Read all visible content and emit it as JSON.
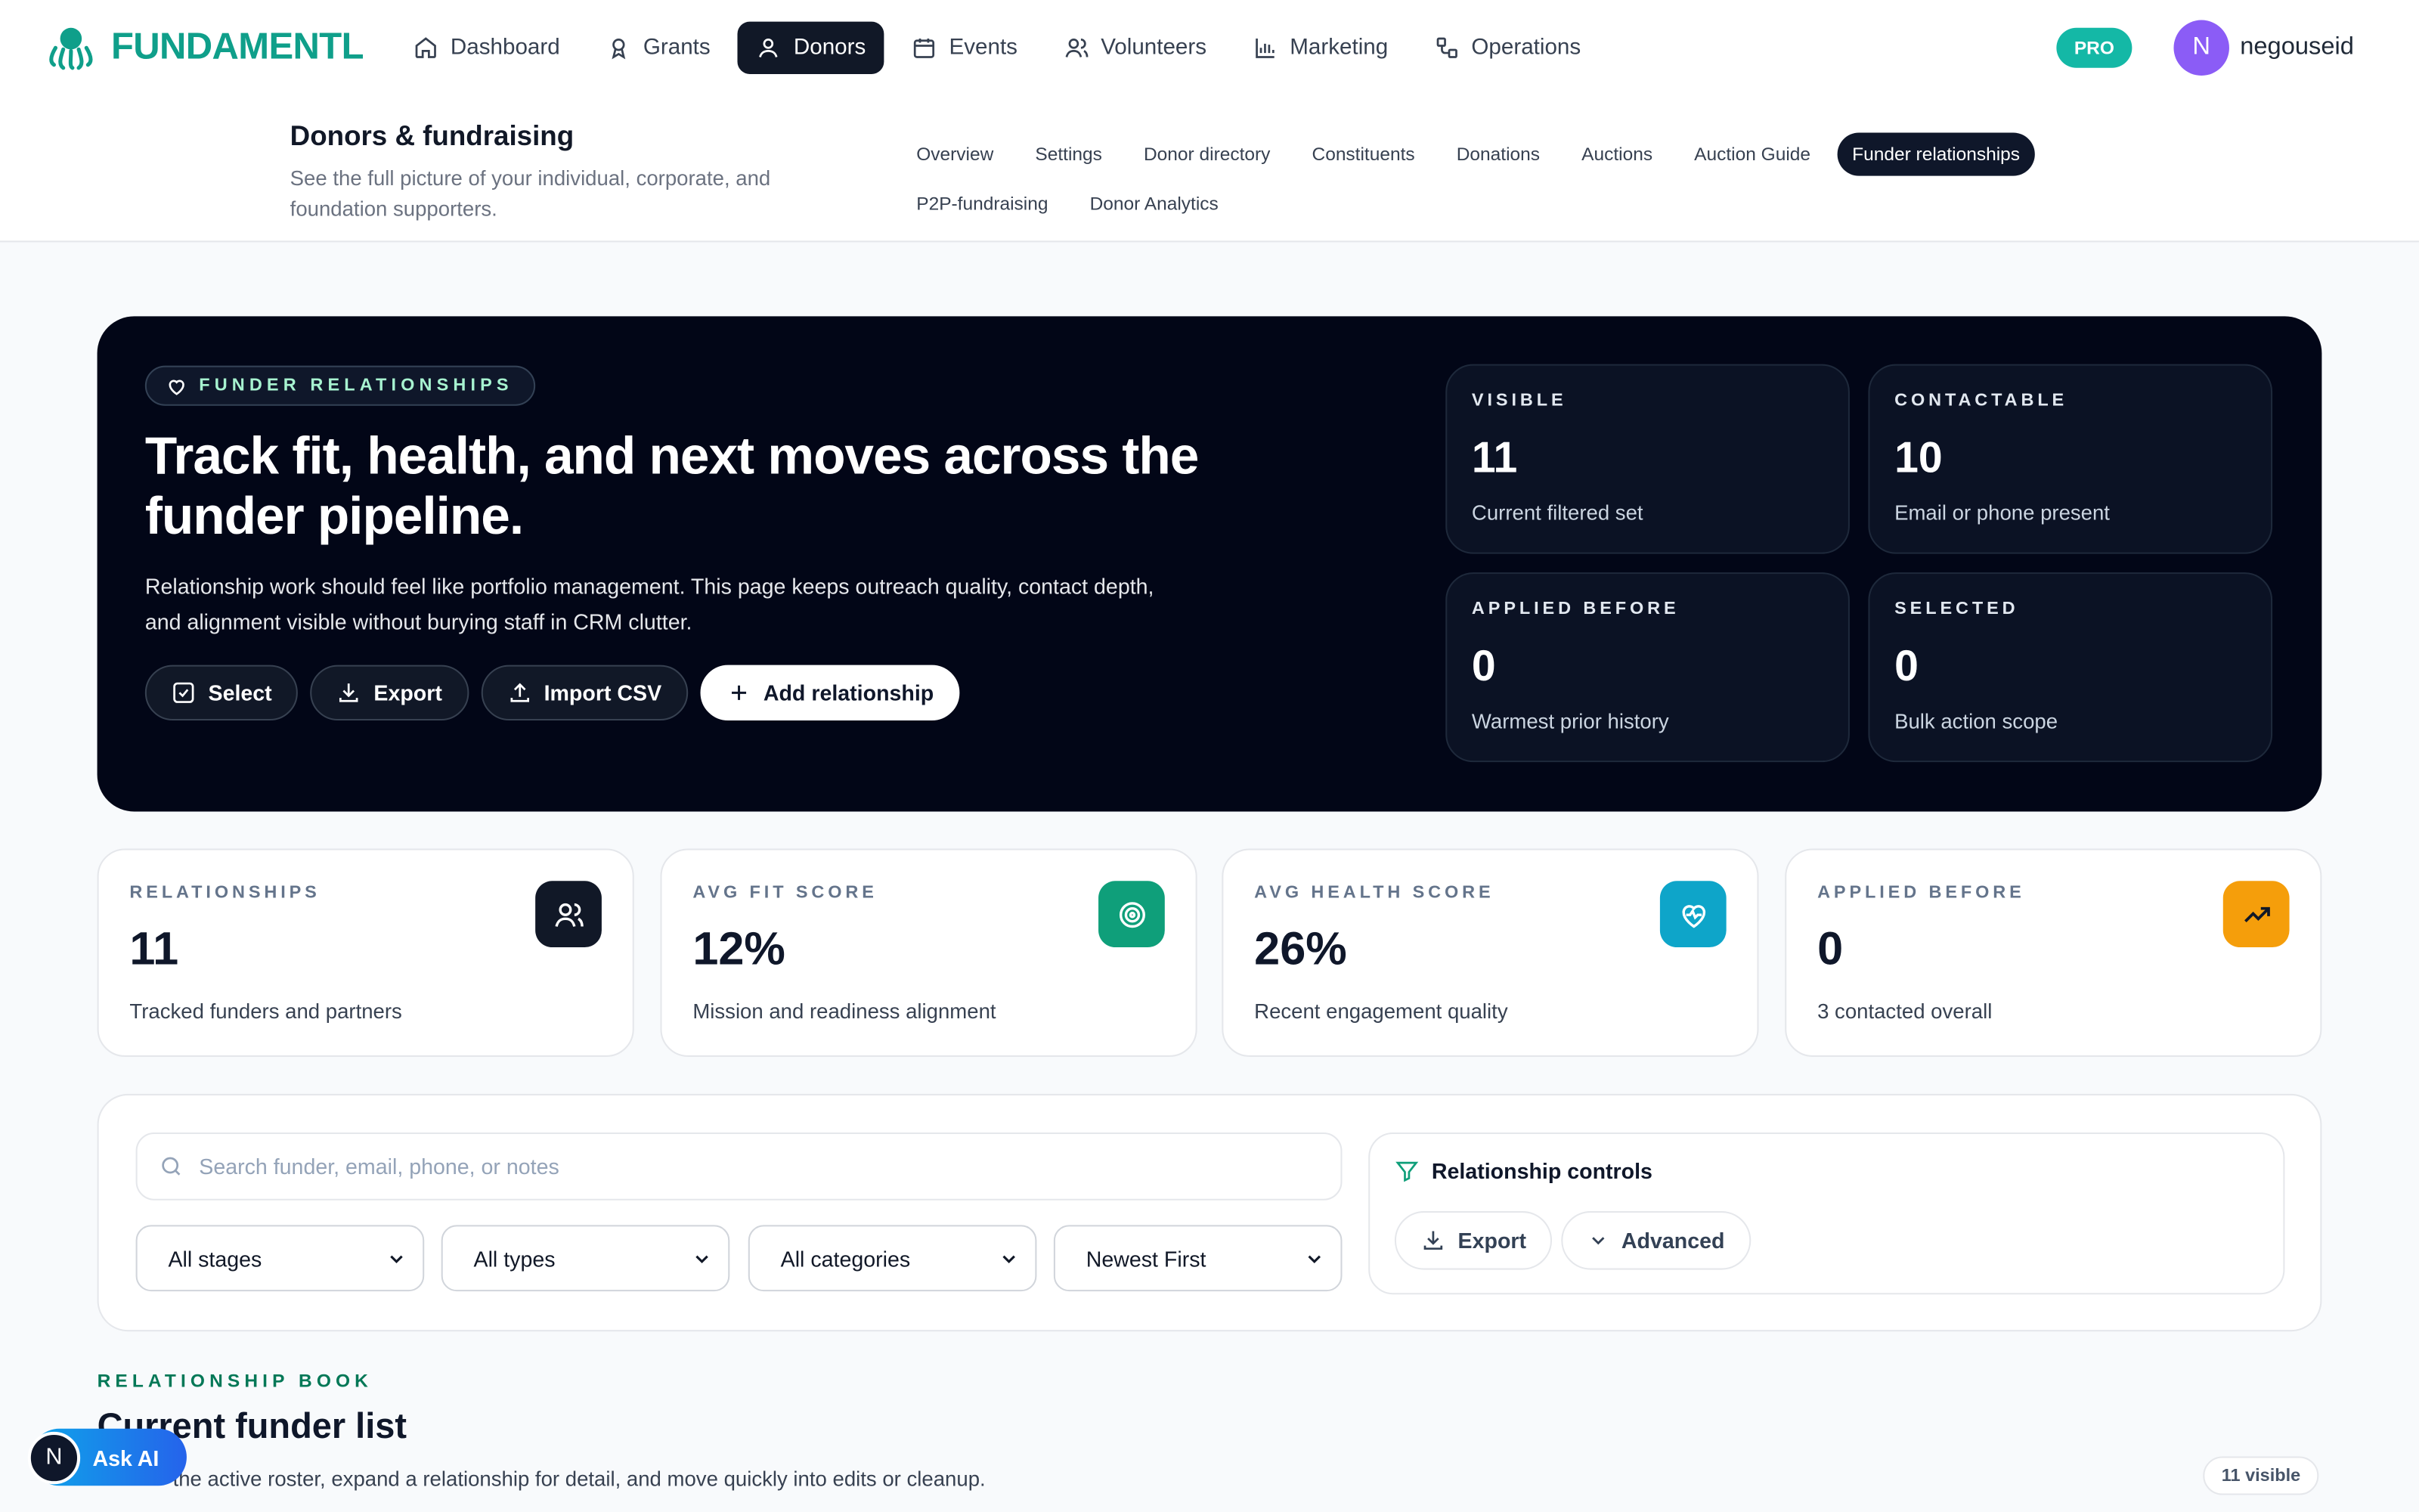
{
  "app": {
    "name": "FUNDAMENTL",
    "badge": "PRO",
    "user": "negouseid",
    "avatar_letter": "N"
  },
  "nav": [
    {
      "label": "Dashboard",
      "icon": "home-icon"
    },
    {
      "label": "Grants",
      "icon": "ribbon-icon"
    },
    {
      "label": "Donors",
      "icon": "user-icon",
      "active": true
    },
    {
      "label": "Events",
      "icon": "calendar-icon"
    },
    {
      "label": "Volunteers",
      "icon": "users-icon"
    },
    {
      "label": "Marketing",
      "icon": "bar-chart-icon"
    },
    {
      "label": "Operations",
      "icon": "workflow-icon"
    }
  ],
  "section": {
    "title": "Donors & fundraising",
    "subtitle": "See the full picture of your individual, corporate, and foundation supporters."
  },
  "subnav": [
    "Overview",
    "Settings",
    "Donor directory",
    "Constituents",
    "Donations",
    "Auctions",
    "Auction Guide",
    "Funder relationships",
    "P2P-fundraising",
    "Donor Analytics"
  ],
  "subnav_active": "Funder relationships",
  "hero": {
    "eyebrow": "FUNDER RELATIONSHIPS",
    "title": "Track fit, health, and next moves across the funder pipeline.",
    "description": "Relationship work should feel like portfolio management. This page keeps outreach quality, contact depth, and alignment visible without burying staff in CRM clutter.",
    "actions": {
      "select": "Select",
      "export": "Export",
      "import": "Import CSV",
      "add": "Add relationship"
    },
    "stats": [
      {
        "label": "VISIBLE",
        "value": "11",
        "sub": "Current filtered set"
      },
      {
        "label": "CONTACTABLE",
        "value": "10",
        "sub": "Email or phone present"
      },
      {
        "label": "APPLIED BEFORE",
        "value": "0",
        "sub": "Warmest prior history"
      },
      {
        "label": "SELECTED",
        "value": "0",
        "sub": "Bulk action scope"
      }
    ]
  },
  "kpis": [
    {
      "label": "RELATIONSHIPS",
      "value": "11",
      "sub": "Tracked funders and partners",
      "icon": "users-icon",
      "color": "#111827"
    },
    {
      "label": "AVG FIT SCORE",
      "value": "12%",
      "sub": "Mission and readiness alignment",
      "icon": "target-icon",
      "color": "#0f9f7a"
    },
    {
      "label": "AVG HEALTH SCORE",
      "value": "26%",
      "sub": "Recent engagement quality",
      "icon": "heart-pulse-icon",
      "color": "#0ea5c9"
    },
    {
      "label": "APPLIED BEFORE",
      "value": "0",
      "sub": "3 contacted overall",
      "icon": "trending-up-icon",
      "color": "#f59e0b"
    }
  ],
  "filters": {
    "search_placeholder": "Search funder, email, phone, or notes",
    "selects": [
      "All stages",
      "All types",
      "All categories",
      "Newest First"
    ],
    "controls_title": "Relationship controls",
    "export": "Export",
    "advanced": "Advanced"
  },
  "book": {
    "eyebrow": "RELATIONSHIP BOOK",
    "title": "Current funder list",
    "subtitle": "the active roster, expand a relationship for detail, and move quickly into edits or cleanup.",
    "visible": "11 visible"
  },
  "ask_ai": {
    "letter": "N",
    "label": "Ask AI"
  }
}
